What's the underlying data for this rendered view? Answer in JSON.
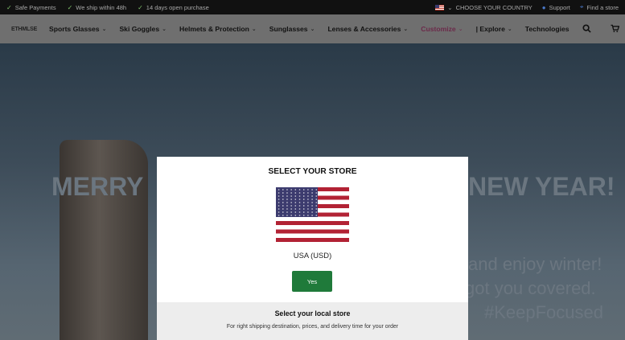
{
  "topbar": {
    "safe_payments": "Safe Payments",
    "ship": "We ship within 48h",
    "open_purchase": "14 days open purchase",
    "choose_country": "CHOOSE YOUR COUNTRY",
    "support": "Support",
    "find_store": "Find a store"
  },
  "nav": {
    "logo": "ETHMLSE",
    "items": [
      {
        "label": "Sports Glasses"
      },
      {
        "label": "Ski Goggles"
      },
      {
        "label": "Helmets & Protection"
      },
      {
        "label": "Sunglasses"
      },
      {
        "label": "Lenses & Accessories"
      },
      {
        "label": "Customize"
      },
      {
        "label": "| Explore"
      },
      {
        "label": "Technologies"
      }
    ]
  },
  "hero": {
    "merry": "MERRY",
    "new_year": "NEW YEAR!",
    "line1": "and enjoy winter!",
    "line2": "got you covered.",
    "line3": "#KeepFocused"
  },
  "modal": {
    "title": "SELECT YOUR STORE",
    "currency": "USA (USD)",
    "yes_label": "Yes",
    "local_title": "Select your local store",
    "local_desc": "For right shipping destination, prices, and delivery time for your order"
  },
  "icons": {
    "check": "check-icon",
    "flag": "us-flag-icon",
    "search": "search-icon",
    "cart": "cart-icon",
    "pin": "location-pin-icon"
  },
  "colors": {
    "accent_customize": "#6c2a4a",
    "yes_button": "#1f7a3a"
  }
}
